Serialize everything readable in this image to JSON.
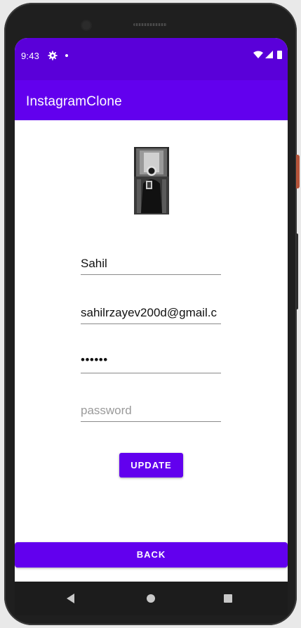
{
  "status_bar": {
    "time": "9:43",
    "icons": [
      "gear-icon",
      "dot-icon",
      "wifi-icon",
      "signal-icon",
      "battery-icon"
    ]
  },
  "app_bar": {
    "title": "InstagramClone"
  },
  "form": {
    "name_value": "Sahil",
    "email_value": "sahilrzayev200d@gmail.c",
    "password_value": "••••••",
    "password_placeholder": "password"
  },
  "buttons": {
    "update_label": "UPDATE",
    "back_label": "BACK"
  },
  "nav_bar": {
    "icons": [
      "nav-back-icon",
      "nav-home-icon",
      "nav-recents-icon"
    ]
  },
  "colors": {
    "primary": "#6200ee",
    "status_bar": "#5a00d9",
    "background": "#ffffff",
    "nav_bar": "#1c1c1c"
  }
}
